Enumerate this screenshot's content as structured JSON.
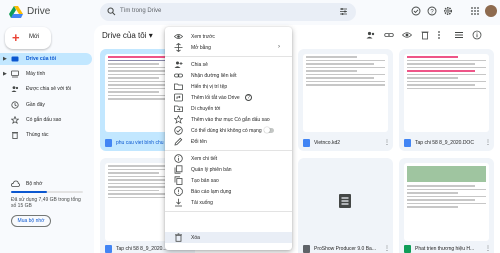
{
  "app": {
    "name": "Drive"
  },
  "search": {
    "placeholder": "Tìm trong Drive"
  },
  "top_icons": [
    "help-icon",
    "settings-icon",
    "apps-icon",
    "account-avatar"
  ],
  "sidebar": {
    "new_label": "Mới",
    "items": [
      {
        "label": "Drive của tôi",
        "icon": "drive-icon",
        "active": true
      },
      {
        "label": "Máy tính",
        "icon": "computer-icon",
        "active": false
      },
      {
        "label": "Được chia sẻ với tôi",
        "icon": "shared-icon",
        "active": false
      },
      {
        "label": "Gần đây",
        "icon": "clock-icon",
        "active": false
      },
      {
        "label": "Có gắn dấu sao",
        "icon": "star-icon",
        "active": false
      },
      {
        "label": "Thùng rác",
        "icon": "trash-icon",
        "active": false
      }
    ],
    "storage": {
      "label": "Bộ nhớ",
      "used_text": "Đã sử dụng 7,49 GB trong tổng số 15 GB",
      "used_fraction": 0.5,
      "buy_label": "Mua bộ nhớ"
    }
  },
  "main": {
    "title": "Drive của tôi",
    "cards": [
      {
        "name": "phu cau viet bình chu",
        "selected": true
      },
      {
        "name": "Vietnco.kd2",
        "selected": false
      },
      {
        "name": "Tap chi 58 8_9_2020.DOC",
        "selected": false
      },
      {
        "name": "Tap chi 58 8_9_2020...",
        "selected": false
      },
      {
        "name": "ProShow Producer 9.0 Ba...",
        "selected": false
      },
      {
        "name": "Phat trien thương hiệu H...",
        "selected": false
      }
    ]
  },
  "context_menu": {
    "items": [
      {
        "label": "Xem trước",
        "icon": "preview-icon"
      },
      {
        "label": "Mở bằng",
        "icon": "open-with-icon",
        "submenu": true
      },
      {
        "label": "Chia sẻ",
        "icon": "share-icon"
      },
      {
        "label": "Nhận đường liên kết",
        "icon": "link-icon"
      },
      {
        "label": "Hiển thị vị trí tệp",
        "icon": "folder-icon"
      },
      {
        "label": "Thêm lối tắt vào Drive",
        "icon": "shortcut-icon",
        "help": true
      },
      {
        "label": "Di chuyển tới",
        "icon": "move-icon"
      },
      {
        "label": "Thêm vào thư mục Có gắn dấu sao",
        "icon": "star-icon"
      },
      {
        "label": "Có thể dùng khi không có mạng",
        "icon": "offline-icon",
        "toggle": true
      },
      {
        "label": "Đổi tên",
        "icon": "edit-icon"
      },
      {
        "label": "Xem chi tiết",
        "icon": "info-icon"
      },
      {
        "label": "Quản lý phiên bản",
        "icon": "versions-icon"
      },
      {
        "label": "Tạo bản sao",
        "icon": "copy-icon"
      },
      {
        "label": "Báo cáo lạm dụng",
        "icon": "report-icon"
      },
      {
        "label": "Tải xuống",
        "icon": "download-icon"
      },
      {
        "label": "Xóa",
        "icon": "delete-icon",
        "highlighted": true
      }
    ]
  },
  "colors": {
    "brand_blue": "#0b57d0",
    "selection_blue": "#c2e7ff",
    "doc_blue": "#4285f4",
    "doc_red": "#ea4335"
  }
}
